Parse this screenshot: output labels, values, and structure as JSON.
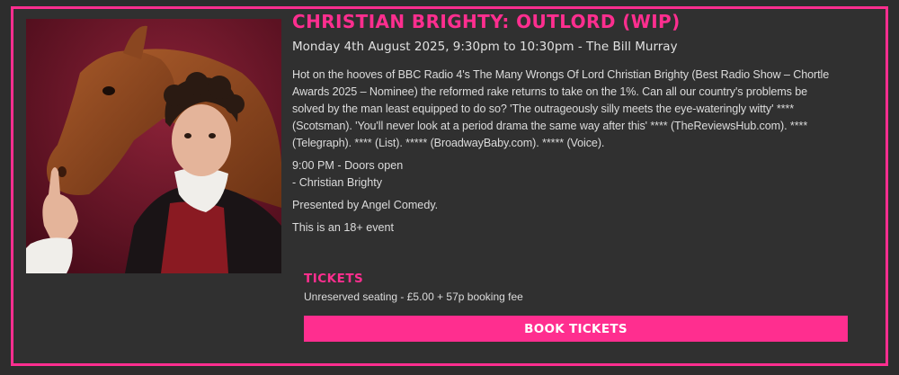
{
  "event": {
    "title": "CHRISTIAN BRIGHTY: OUTLORD (WIP)",
    "date_line": "Monday 4th August 2025, 9:30pm to 10:30pm - The Bill Murray",
    "description": "Hot on the hooves of BBC Radio 4's The Many Wrongs Of Lord Christian Brighty (Best Radio Show – Chortle Awards 2025 – Nominee) the reformed rake returns to take on the 1%. Can all our country's problems be solved by the man least equipped to do so? 'The outrageously silly meets the eye-wateringly witty' **** (Scotsman). 'You'll never look at a period drama the same way after this' **** (TheReviewsHub.com). **** (Telegraph). **** (List). ***** (BroadwayBaby.com). ***** (Voice).",
    "lineup": [
      "9:00 PM - Doors open",
      "- Christian Brighty"
    ],
    "presented_by": "Presented by Angel Comedy.",
    "age_notice": "This is an 18+ event"
  },
  "tickets": {
    "heading": "TICKETS",
    "seating": "Unreserved seating - £5.00 + 57p booking fee",
    "button_label": "BOOK TICKETS"
  },
  "colors": {
    "accent": "#ff2e8f",
    "background": "#303030",
    "text": "#dcdcdc"
  }
}
